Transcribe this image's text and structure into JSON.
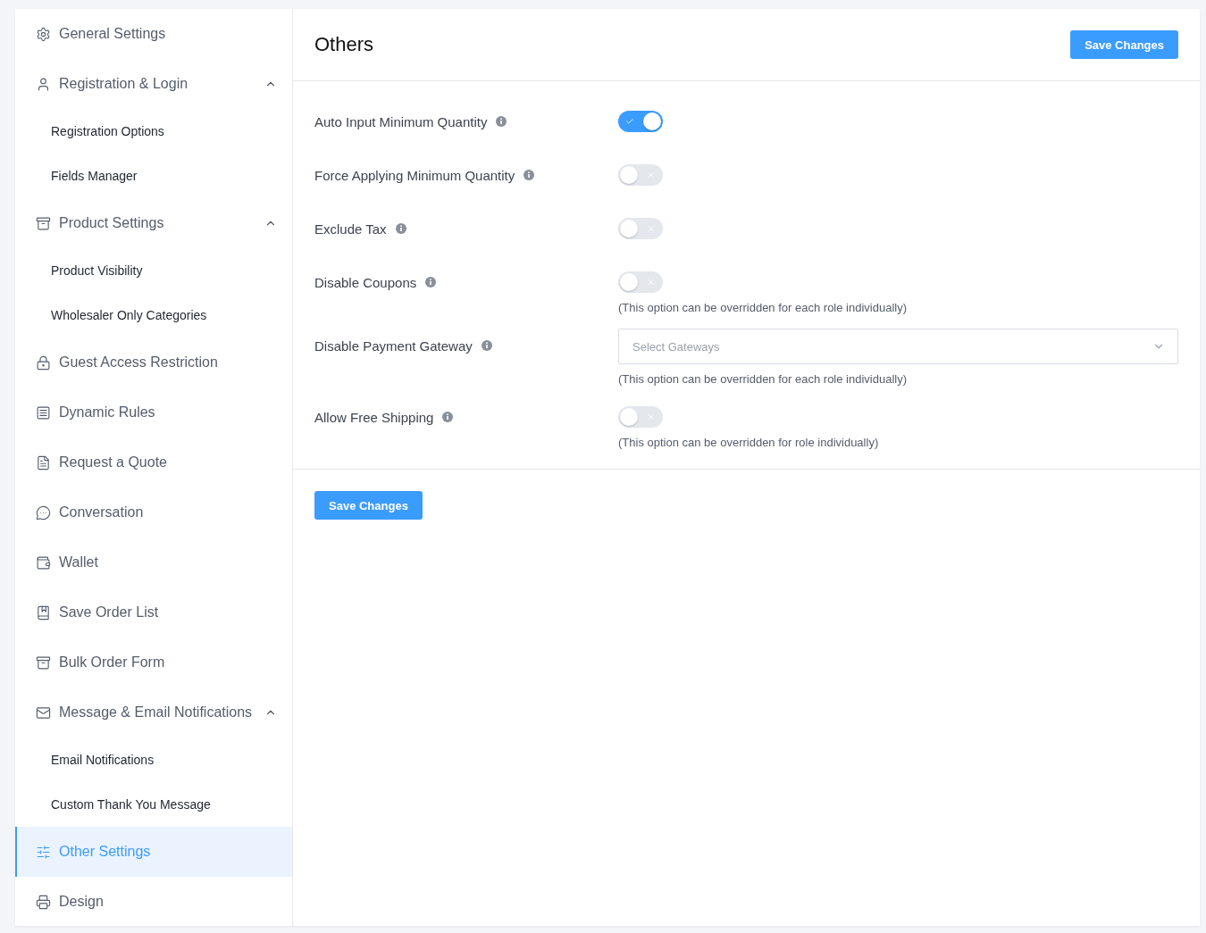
{
  "sidebar": {
    "items": [
      {
        "label": "General Settings",
        "selected": false
      },
      {
        "label": "Registration & Login",
        "selected": false,
        "expanded": true,
        "children": [
          {
            "label": "Registration Options",
            "selected": false
          },
          {
            "label": "Fields Manager",
            "selected": false
          }
        ]
      },
      {
        "label": "Product Settings",
        "selected": false,
        "expanded": true,
        "children": [
          {
            "label": "Product Visibility",
            "selected": false
          },
          {
            "label": "Wholesaler Only Categories",
            "selected": false
          }
        ]
      },
      {
        "label": "Guest Access Restriction",
        "selected": false
      },
      {
        "label": "Dynamic Rules",
        "selected": false
      },
      {
        "label": "Request a Quote",
        "selected": false
      },
      {
        "label": "Conversation",
        "selected": false
      },
      {
        "label": "Wallet",
        "selected": false
      },
      {
        "label": "Save Order List",
        "selected": false
      },
      {
        "label": "Bulk Order Form",
        "selected": false
      },
      {
        "label": "Message & Email Notifications",
        "selected": false,
        "expanded": true,
        "children": [
          {
            "label": "Email Notifications",
            "selected": false
          },
          {
            "label": "Custom Thank You Message",
            "selected": false
          }
        ]
      },
      {
        "label": "Other Settings",
        "selected": true
      },
      {
        "label": "Design",
        "selected": false
      }
    ]
  },
  "page": {
    "title": "Others",
    "save_button": "Save Changes"
  },
  "settings": [
    {
      "kind": "toggle",
      "label": "Auto Input Minimum Quantity",
      "on": true
    },
    {
      "kind": "toggle",
      "label": "Force Applying Minimum Quantity",
      "on": false
    },
    {
      "kind": "toggle",
      "label": "Exclude Tax",
      "on": false
    },
    {
      "kind": "toggle",
      "label": "Disable Coupons",
      "on": false,
      "note": "(This option can be overridden for each role individually)"
    },
    {
      "kind": "select",
      "label": "Disable Payment Gateway",
      "placeholder": "Select Gateways",
      "note": "(This option can be overridden for each role individually)"
    },
    {
      "kind": "toggle",
      "label": "Allow Free Shipping",
      "on": false,
      "note": "(This option can be overridden for role individually)"
    }
  ],
  "footer": {
    "save_button": "Save Changes"
  }
}
